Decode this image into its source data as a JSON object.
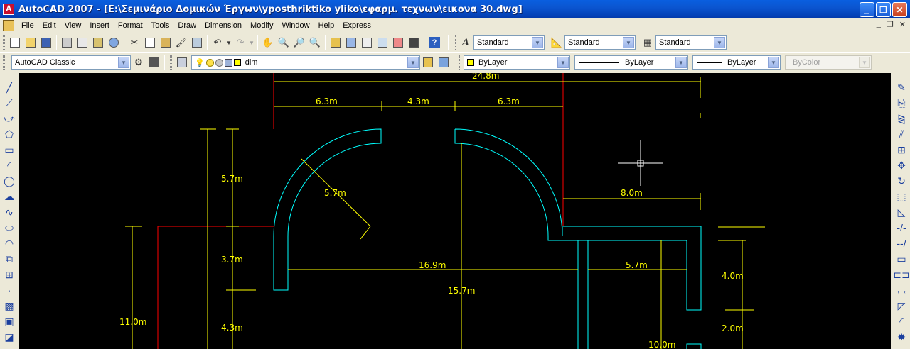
{
  "window": {
    "title": "AutoCAD 2007 - [E:\\Σεμινάριο Δομικών Έργων\\yposthriktiko yliko\\εφαρμ. τεχνων\\εικονα 30.dwg]",
    "minimize": "_",
    "maximize": "❐",
    "close": "✕"
  },
  "menu": {
    "items": [
      "File",
      "Edit",
      "View",
      "Insert",
      "Format",
      "Tools",
      "Draw",
      "Dimension",
      "Modify",
      "Window",
      "Help",
      "Express"
    ],
    "doc_minimize": "_",
    "doc_restore": "❐",
    "doc_close": "✕"
  },
  "styles_toolbar": {
    "text_style": "Standard",
    "dim_style": "Standard",
    "table_style": "Standard"
  },
  "workspace_toolbar": {
    "workspace": "AutoCAD Classic"
  },
  "layers_toolbar": {
    "current_layer": "dim"
  },
  "properties_toolbar": {
    "color": "ByLayer",
    "linetype": "ByLayer",
    "lineweight": "ByLayer",
    "plotstyle": "ByColor"
  },
  "icons": {
    "left_toolbar": [
      "line-icon",
      "construction-line-icon",
      "polyline-icon",
      "polygon-icon",
      "rectangle-icon",
      "arc-icon",
      "circle-icon",
      "revision-cloud-icon",
      "spline-icon",
      "ellipse-icon",
      "ellipse-arc-icon",
      "insert-block-icon",
      "make-block-icon",
      "point-icon",
      "hatch-icon",
      "gradient-icon",
      "region-icon"
    ],
    "right_toolbar": [
      "erase-icon",
      "copy-icon",
      "mirror-icon",
      "offset-icon",
      "array-icon",
      "move-icon",
      "rotate-icon",
      "scale-icon",
      "stretch-icon",
      "trim-icon",
      "extend-icon",
      "break-at-point-icon",
      "break-icon",
      "join-icon",
      "chamfer-icon",
      "fillet-icon",
      "explode-icon"
    ]
  },
  "drawing": {
    "colors": {
      "background": "#000000",
      "wall": "#00FFFF",
      "dimension": "#FFFF00",
      "reference": "#FF0000",
      "crosshair": "#FFFFFF"
    },
    "dimensions": {
      "overall_top": "24.8m",
      "top_left": "6.3m",
      "top_mid": "4.3m",
      "top_right": "6.3m",
      "left_upper": "5.7m",
      "left_mid": "3.7m",
      "left_lower": "4.3m",
      "left_total": "11.0m",
      "radius": "5.7m",
      "right_top": "8.0m",
      "inner_horizontal": "16.9m",
      "inner_right": "5.7m",
      "inner_vertical": "15.7m",
      "right_side_upper": "4.0m",
      "right_side_mid": "2.0m",
      "bottom_right": "10.0m"
    }
  }
}
